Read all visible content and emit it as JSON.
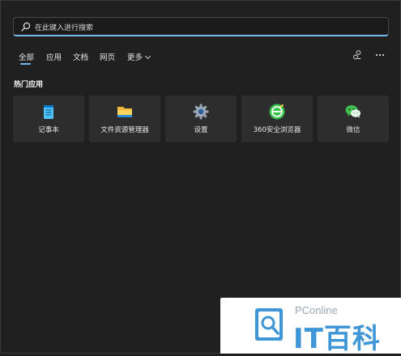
{
  "search": {
    "placeholder": "在此键入进行搜索",
    "icon": "search-icon"
  },
  "tabs": [
    {
      "label": "全部",
      "active": true
    },
    {
      "label": "应用"
    },
    {
      "label": "文档"
    },
    {
      "label": "网页"
    },
    {
      "label": "更多"
    }
  ],
  "toolbar": {
    "icons": [
      "account-switch-icon",
      "more-options-icon"
    ]
  },
  "section": {
    "title": "热门应用"
  },
  "apps": [
    {
      "label": "记事本",
      "icon": "notepad-icon"
    },
    {
      "label": "文件资源管理器",
      "icon": "folder-icon"
    },
    {
      "label": "设置",
      "icon": "gear-icon"
    },
    {
      "label": "360安全浏览器",
      "icon": "browser-360-icon"
    },
    {
      "label": "微信",
      "icon": "wechat-icon"
    }
  ],
  "watermark": {
    "brand_sub": "PConline",
    "brand_main": "IT百科"
  },
  "colors": {
    "accent": "#76b9ed",
    "background": "#202020",
    "tile": "#2d2d2d"
  }
}
